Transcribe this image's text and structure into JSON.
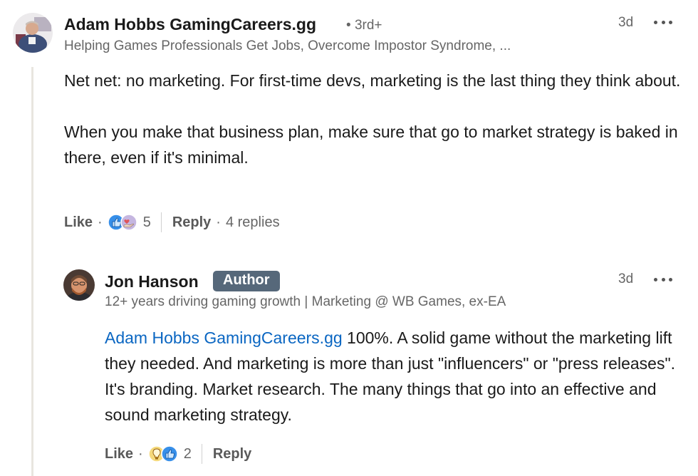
{
  "comment": {
    "author": "Adam Hobbs GamingCareers.gg",
    "degree": "3rd+",
    "headline": "Helping Games Professionals Get Jobs, Overcome Impostor Syndrome, ...",
    "time": "3d",
    "paragraphs": [
      "Net net: no marketing. For first-time devs, marketing is the last thing they think about.",
      "When you make that business plan, make sure that go to market strategy is baked in there, even if it's minimal."
    ],
    "like_label": "Like",
    "reaction_count": "5",
    "reply_label": "Reply",
    "replies_count": "4 replies",
    "reaction_icons": [
      "support-heart-hand-icon",
      "like-thumb-icon"
    ]
  },
  "reply": {
    "author": "Jon Hanson",
    "badge": "Author",
    "headline": "12+ years driving gaming growth | Marketing @ WB Games, ex-EA",
    "time": "3d",
    "mention": "Adam Hobbs GamingCareers.gg",
    "text": " 100%. A solid game without the marketing lift they needed. And marketing is more than just \"influencers\" or \"press releases\". It's branding. Market research. The many things that go into an effective and sound marketing strategy.",
    "like_label": "Like",
    "reaction_count": "2",
    "reply_label": "Reply",
    "reaction_icons": [
      "insightful-lightbulb-icon",
      "like-thumb-icon"
    ]
  },
  "colors": {
    "mention": "#0a66c2",
    "badge_bg": "#56687a",
    "thread_line": "#e8e5df"
  }
}
